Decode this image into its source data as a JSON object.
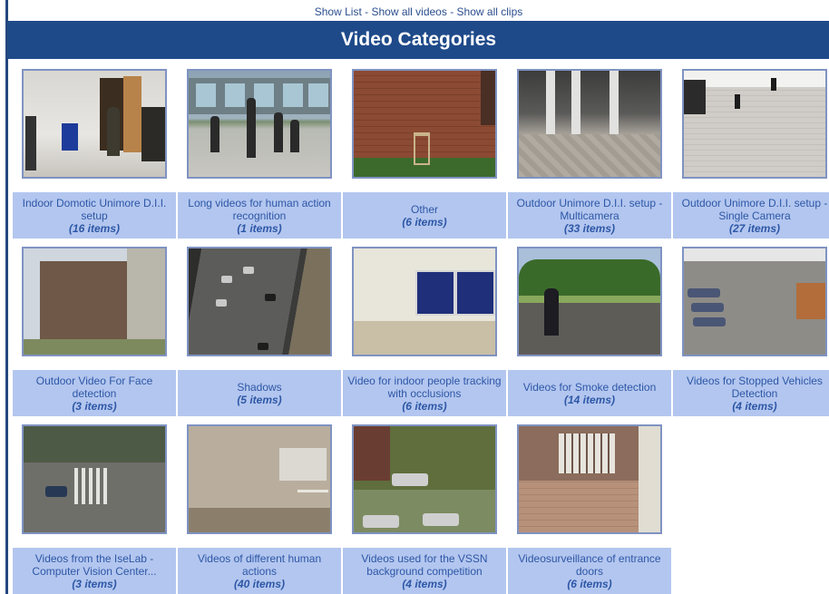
{
  "top_links": {
    "show_list": "Show List",
    "show_all_videos": "Show all videos",
    "show_all_clips": "Show all clips",
    "separator": "-"
  },
  "title": "Video Categories",
  "categories": [
    {
      "name": "Indoor Domotic Unimore D.I.I. setup",
      "count": "(16 items)"
    },
    {
      "name": "Long videos for human action recognition",
      "count": "(1 items)"
    },
    {
      "name": "Other",
      "count": "(6 items)"
    },
    {
      "name": "Outdoor Unimore D.I.I. setup - Multicamera",
      "count": "(33 items)"
    },
    {
      "name": "Outdoor Unimore D.I.I. setup - Single Camera",
      "count": "(27 items)"
    },
    {
      "name": "Outdoor Video For Face detection",
      "count": "(3 items)"
    },
    {
      "name": "Shadows",
      "count": "(5 items)"
    },
    {
      "name": "Video for indoor people tracking with occlusions",
      "count": "(6 items)"
    },
    {
      "name": "Videos for Smoke detection",
      "count": "(14 items)"
    },
    {
      "name": "Videos for Stopped Vehicles Detection",
      "count": "(4 items)"
    },
    {
      "name": "Videos from the IseLab - Computer Vision Center...",
      "count": "(3 items)"
    },
    {
      "name": "Videos of different human actions",
      "count": "(40 items)"
    },
    {
      "name": "Videos used for the VSSN background competition",
      "count": "(4 items)"
    },
    {
      "name": "Videosurveillance of entrance doors",
      "count": "(6 items)"
    }
  ],
  "colors": {
    "title_bar": "#1f4a8a",
    "caption_bg": "#b3c6ef",
    "link": "#2d57a6"
  }
}
